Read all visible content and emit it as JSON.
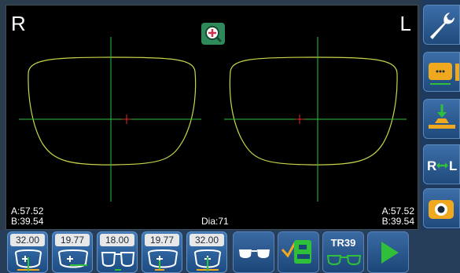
{
  "left_label": "R",
  "right_label": "L",
  "right_lens": {
    "a": "A:57.52",
    "b": "B:39.54"
  },
  "left_lens": {
    "a": "A:57.52",
    "b": "B:39.54"
  },
  "dia": "Dia:71",
  "tiles": [
    {
      "value": "32.00",
      "icon": "frame-width-icon"
    },
    {
      "value": "19.77",
      "icon": "frame-pd-icon"
    },
    {
      "value": "18.00",
      "icon": "bridge-icon"
    },
    {
      "value": "19.77",
      "icon": "height-icon"
    },
    {
      "value": "32.00",
      "icon": "frame-width-icon"
    }
  ],
  "tr_label": "TR39",
  "colors": {
    "frame": "#c9d64a",
    "axis": "#2fbf3a",
    "center": "#d83030",
    "accent": "#f0a81e"
  }
}
